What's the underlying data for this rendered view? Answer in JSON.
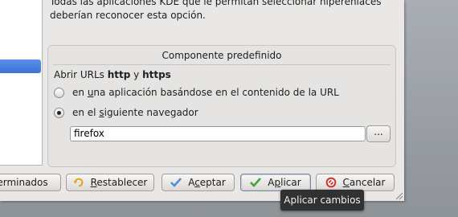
{
  "intro": {
    "line1": "Todas las aplicaciones KDE que le permitan seleccionar hiperenlaces",
    "line2": "deberían reconocer esta opción."
  },
  "group": {
    "title": "Componente predefinido",
    "label_prefix": "Abrir URLs ",
    "label_http": "http",
    "label_and": " y ",
    "label_https": "https"
  },
  "options": {
    "content_based": {
      "pre": "en ",
      "mn": "u",
      "post": "na aplicación basándose en el contenido de la URL",
      "checked": false
    },
    "browser": {
      "pre": "en el ",
      "mn": "s",
      "post": "iguiente navegador",
      "checked": true
    }
  },
  "browser_field": {
    "value": "firefox"
  },
  "browse_button": {
    "label": "..."
  },
  "buttons": {
    "defaults": "erminados",
    "reset_mn": "R",
    "reset_rest": "establecer",
    "ok_pre": "A",
    "ok_mn": "c",
    "ok_rest": "eptar",
    "apply_pre": "A",
    "apply_mn": "p",
    "apply_rest": "licar",
    "cancel_mn": "C",
    "cancel_rest": "ancelar"
  },
  "tooltip": "Aplicar cambios",
  "colors": {
    "selection": "#3e73d6",
    "ok_check": "#4a90d9",
    "apply_check": "#3fa33f",
    "cancel_red": "#d02a22",
    "reset_yellow": "#e0a81c",
    "tooltip_bg": "#2f3133"
  }
}
